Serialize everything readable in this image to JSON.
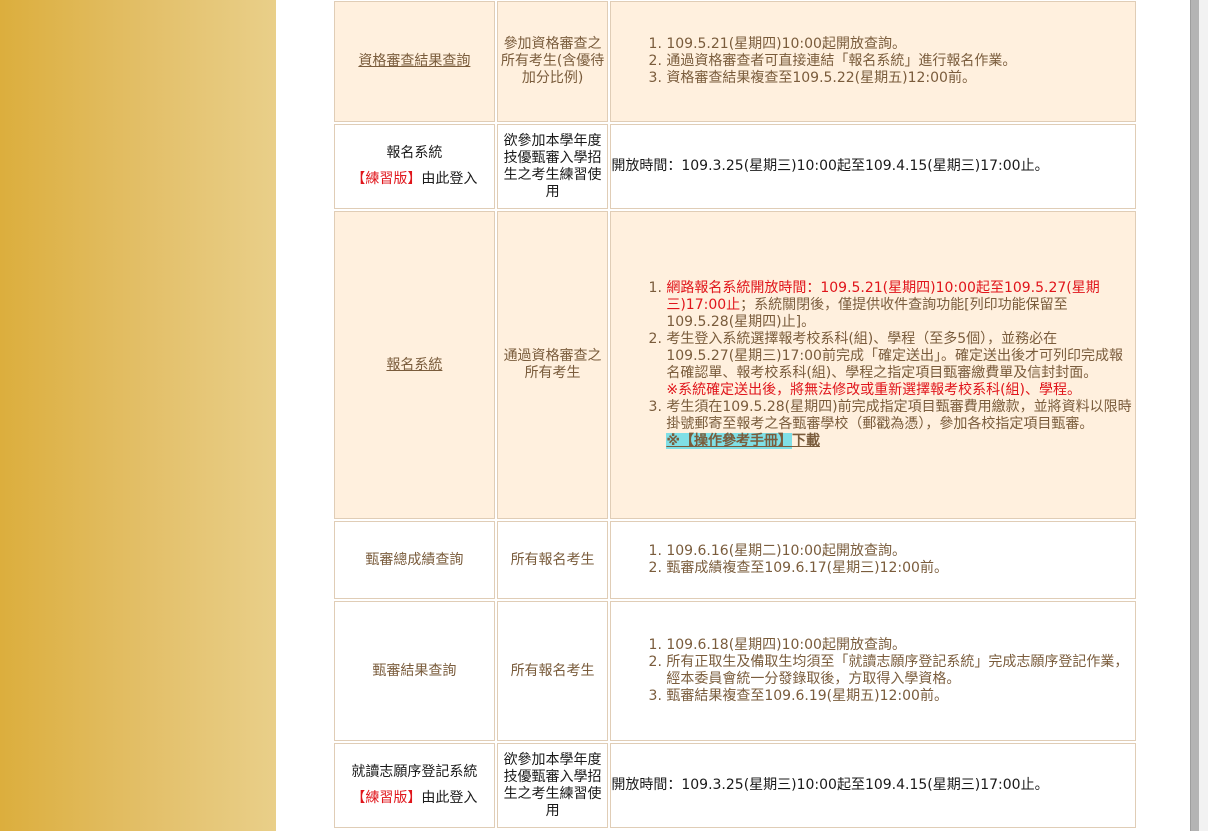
{
  "rows": [
    {
      "item": "資格審查結果查詢",
      "target": "參加資格審查之所有考生(含優待加分比例)",
      "items": [
        "109.5.21(星期四)10:00起開放查詢。",
        "通過資格審查者可直接連結「報名系統」進行報名作業。",
        "資格審查結果複查至109.5.22(星期五)12:00前。"
      ]
    },
    {
      "item": "報名系統",
      "practice_tag": "【練習版】",
      "login_text": "由此登入",
      "target": "欲參加本學年度技優甄審入學招生之考生練習使用",
      "label": "開放時間：",
      "text": "109.3.25(星期三)10:00起至109.4.15(星期三)17:00止。"
    },
    {
      "item": "報名系統",
      "target": "通過資格審查之所有考生",
      "item1_red": "網路報名系統開放時間：109.5.21(星期四)10:00起至109.5.27(星期三)17:00止",
      "item1_rest": "；系統關閉後，僅提供收件查詢功能[列印功能保留至109.5.28(星期四)止]。",
      "item2": "考生登入系統選擇報考校系科(組)、學程（至多5個），並務必在109.5.27(星期三)17:00前完成「確定送出」。確定送出後才可列印完成報名確認單、報考校系科(組)、學程之指定項目甄審繳費單及信封封面。",
      "item2_note": "※系統確定送出後，將無法修改或重新選擇報考校系科(組)、學程。",
      "item3": "考生須在109.5.28(星期四)前完成指定項目甄審費用繳款，並將資料以限時掛號郵寄至報考之各甄審學校（郵戳為憑），參加各校指定項目甄審。",
      "manual_highlight": "※【操作參考手冊】",
      "manual_download": "下載"
    },
    {
      "item": "甄審總成績查詢",
      "target": "所有報名考生",
      "items": [
        "109.6.16(星期二)10:00起開放查詢。",
        "甄審成績複查至109.6.17(星期三)12:00前。"
      ]
    },
    {
      "item": "甄審結果查詢",
      "target": "所有報名考生",
      "items": [
        "109.6.18(星期四)10:00起開放查詢。",
        "所有正取生及備取生均須至「就讀志願序登記系統」完成志願序登記作業，經本委員會統一分發錄取後，方取得入學資格。",
        "甄審結果複查至109.6.19(星期五)12:00前。"
      ]
    },
    {
      "item": "就讀志願序登記系統",
      "practice_tag": "【練習版】",
      "login_text": "由此登入",
      "target": "欲參加本學年度技優甄審入學招生之考生練習使用",
      "label": "開放時間：",
      "text": "109.3.25(星期三)10:00起至109.4.15(星期三)17:00止。"
    }
  ]
}
